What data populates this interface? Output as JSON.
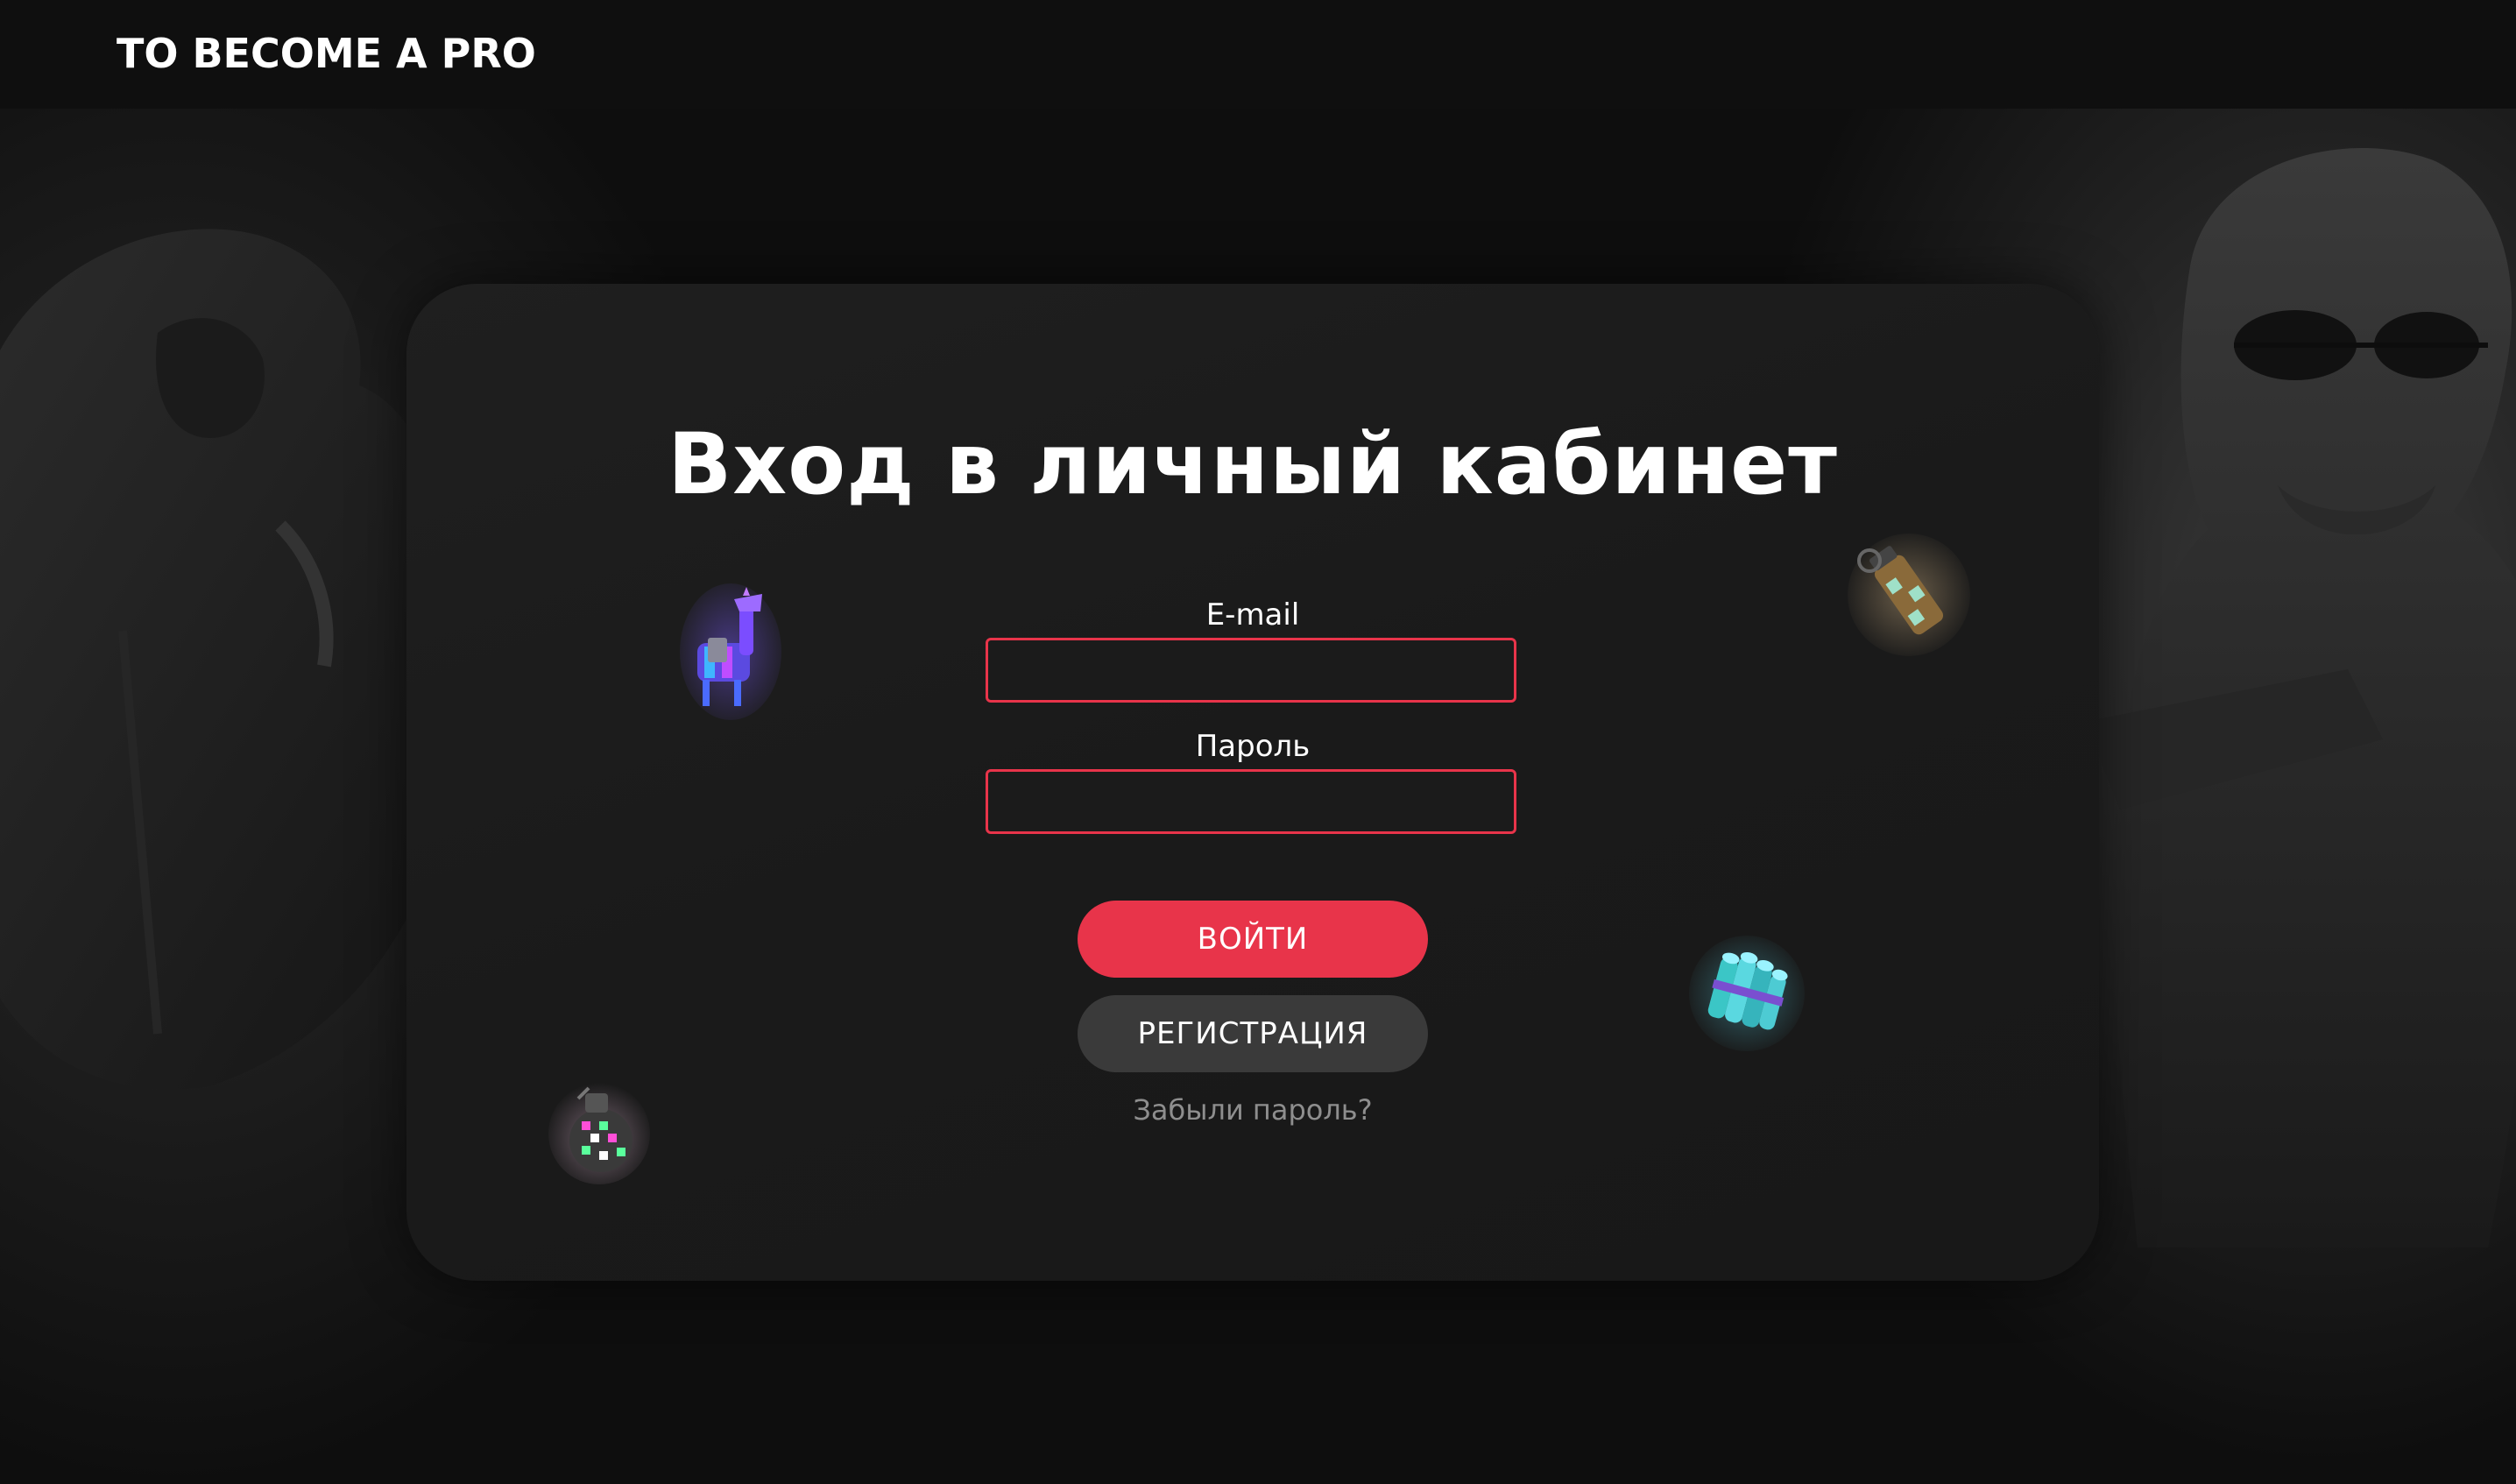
{
  "header": {
    "logo_text": "TO BECOME A PRO"
  },
  "login": {
    "title": "Вход в личный кабинет",
    "email_label": "E-mail",
    "email_value": "",
    "password_label": "Пароль",
    "password_value": "",
    "login_button": "ВОЙТИ",
    "register_button": "РЕГИСТРАЦИЯ",
    "forgot_link": "Забыли пароль?"
  },
  "decorations": {
    "items": [
      "llama-icon",
      "grenade-disco-icon",
      "smoke-grenade-icon",
      "dynamite-bundle-icon"
    ]
  },
  "colors": {
    "accent": "#e8344a",
    "secondary_button": "#3a3a3a",
    "card_bg": "#1c1c1c",
    "page_bg": "#0e0e0e",
    "muted_text": "#8e8e8e"
  }
}
